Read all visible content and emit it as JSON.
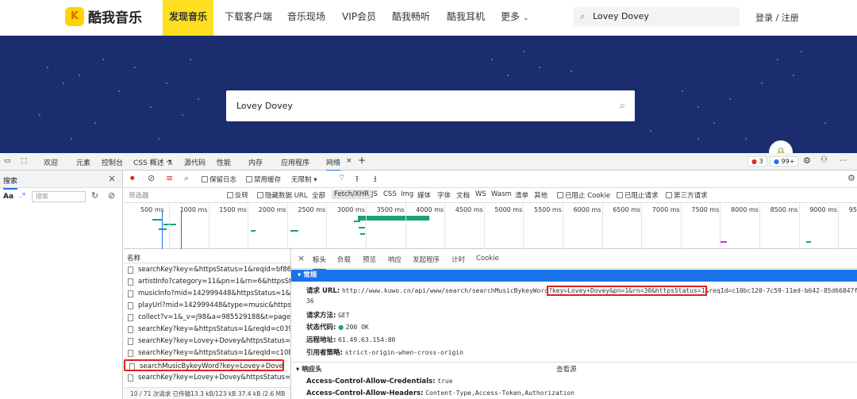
{
  "site": {
    "logo_mark": "K",
    "logo_text": "酷我音乐",
    "nav": [
      "发现音乐",
      "下载客户端",
      "音乐现场",
      "VIP会员",
      "酷我畅听",
      "酷我耳机",
      "更多"
    ],
    "more_chevron": "chevron-down-icon",
    "search_value": "Lovey Dovey",
    "login": "登录 / 注册",
    "banner_search_value": "Lovey Dovey"
  },
  "devtools": {
    "tabs": [
      "欢迎",
      "元素",
      "控制台",
      "CSS 概述 ⚗",
      "源代码",
      "性能",
      "内存",
      "应用程序",
      "网络"
    ],
    "active_tab": "网络",
    "error_count": "3",
    "message_count": "99+",
    "search_panel_title": "搜索",
    "search_placeholder": "搜索",
    "search_aa": "Aa",
    "search_regex": ".*",
    "toolbar": {
      "preserve_log": "保留日志",
      "disable_cache": "禁用缓存",
      "throttle": "无限制"
    },
    "filter": {
      "placeholder": "筛选器",
      "invert": "反转",
      "hide_data_urls": "隐藏数据 URL",
      "types": [
        "全部",
        "Fetch/XHR",
        "JS",
        "CSS",
        "Img",
        "媒体",
        "字体",
        "文档",
        "WS",
        "Wasm",
        "清单",
        "其他"
      ],
      "active_type": "Fetch/XHR",
      "blocked_cookies": "已阻止 Cookie",
      "blocked_requests": "已阻止请求",
      "third_party": "第三方请求"
    },
    "timeline_ticks": [
      "500 ms",
      "1000 ms",
      "1500 ms",
      "2000 ms",
      "2500 ms",
      "3000 ms",
      "3500 ms",
      "4000 ms",
      "4500 ms",
      "5000 ms",
      "5500 ms",
      "6000 ms",
      "6500 ms",
      "7000 ms",
      "7500 ms",
      "8000 ms",
      "8500 ms",
      "9000 ms",
      "95"
    ],
    "request_list": {
      "header": "名称",
      "rows": [
        "searchKey?key=&httpsStatus=1&reqId=bf86f5e...",
        "artistInfo?category=11&pn=1&rn=6&httpsStatu...",
        "musicInfo?mid=142999448&httpsStatus=1&req...",
        "playUrl?mid=142999448&type=music&httpsStat...",
        "collect?v=1&_v=j98&a=985529188&t=pagevie...",
        "searchKey?key=&httpsStatus=1&reqId=c039a4...",
        "searchKey?key=Lovey+Dovey&httpsStatus=1&req...",
        "searchKey?key=&httpsStatus=1&reqId=c10b73...",
        "searchMusicBykeyWord?key=Lovey+Dovey&pn...",
        "searchKey?key=Lovey+Dovey&httpsStatus=1&r..."
      ],
      "selected_index": 8,
      "footer": "10 / 71 次请求  已传输13.3 kB/123 kB  37.4 kB /2.6 MB"
    },
    "detail": {
      "tabs": [
        "标头",
        "负载",
        "预览",
        "响应",
        "发起程序",
        "计时",
        "Cookie"
      ],
      "active_tab": "标头",
      "general_title": "常规",
      "request_url_key": "请求 URL:",
      "request_url_prefix": "http://www.kuwo.cn/api/www/search/searchMusicBykeyWord",
      "request_url_highlight": "?key=Lovey+Dovey&pn=1&rn=30&httpsStatus=1",
      "request_url_suffix": "&reqId=c10bc120-7c59-11ed-b642-85d66847f0",
      "request_url_wrap": "36",
      "method_key": "请求方法:",
      "method_value": "GET",
      "status_key": "状态代码:",
      "status_value": "200 OK",
      "remote_key": "远程地址:",
      "remote_value": "61.49.63.154:80",
      "referrer_key": "引用者策略:",
      "referrer_value": "strict-origin-when-cross-origin",
      "response_title": "响应头",
      "view_source": "查看源",
      "acac_key": "Access-Control-Allow-Credentials:",
      "acac_value": "true",
      "acah_key": "Access-Control-Allow-Headers:",
      "acah_value": "Content-Type,Access-Token,Authorization"
    }
  },
  "colors": {
    "brand_yellow": "#ffdf1f",
    "banner_blue": "#1b2d6e",
    "devtools_blue": "#1a73e8",
    "highlight_red": "#e02020"
  }
}
